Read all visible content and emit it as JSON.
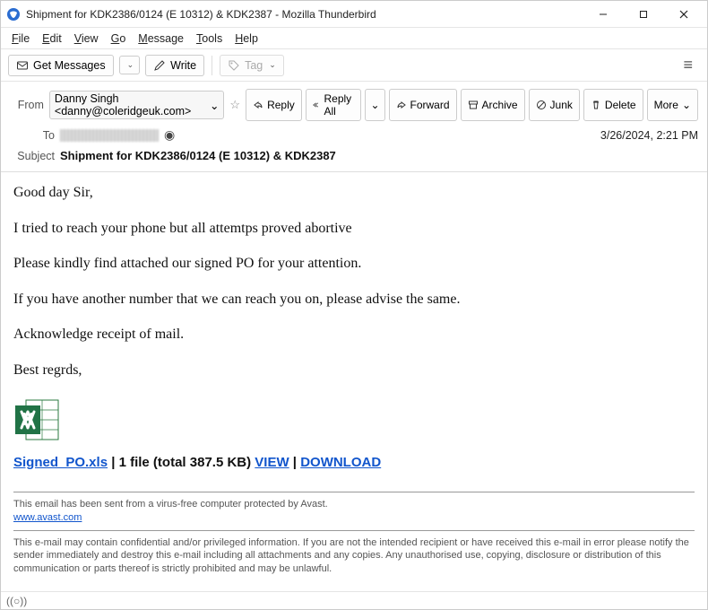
{
  "window": {
    "title": "Shipment for KDK2386/0124 (E 10312) & KDK2387 - Mozilla Thunderbird"
  },
  "menu": {
    "file": "File",
    "edit": "Edit",
    "view": "View",
    "go": "Go",
    "message": "Message",
    "tools": "Tools",
    "help": "Help"
  },
  "toolbar": {
    "get_messages": "Get Messages",
    "write": "Write",
    "tag": "Tag"
  },
  "header": {
    "from_label": "From",
    "from_value": "Danny Singh <danny@coleridgeuk.com>",
    "to_label": "To",
    "subject_label": "Subject",
    "subject_value": "Shipment for KDK2386/0124 (E 10312) & KDK2387",
    "date": "3/26/2024, 2:21 PM"
  },
  "actions": {
    "reply": "Reply",
    "reply_all": "Reply All",
    "forward": "Forward",
    "archive": "Archive",
    "junk": "Junk",
    "delete": "Delete",
    "more": "More"
  },
  "body": {
    "p1": "Good day Sir,",
    "p2": "I tried to reach your phone but all attemtps proved abortive",
    "p3": "Please kindly find attached our signed PO for your attention.",
    "p4": "If you have another number that we can reach you on, please advise the same.",
    "p5": "Acknowledge receipt of mail.",
    "p6": "Best regrds,"
  },
  "attachment": {
    "filename": "Signed_PO.xls",
    "meta": " | 1 file (total 387.5 KB) ",
    "view": "VIEW",
    "sep": " | ",
    "download": "DOWNLOAD"
  },
  "footer": {
    "avast": "This email has been sent from a virus-free computer protected by Avast.",
    "avast_link": "www.avast.com",
    "disclaimer": "This e-mail may contain confidential and/or privileged information. If you are not the intended recipient or have received this e-mail in error please notify the sender immediately and destroy this e-mail including all attachments and any copies. Any unauthorised use, copying, disclosure or distribution of this communication or parts thereof is strictly prohibited and may be unlawful."
  }
}
